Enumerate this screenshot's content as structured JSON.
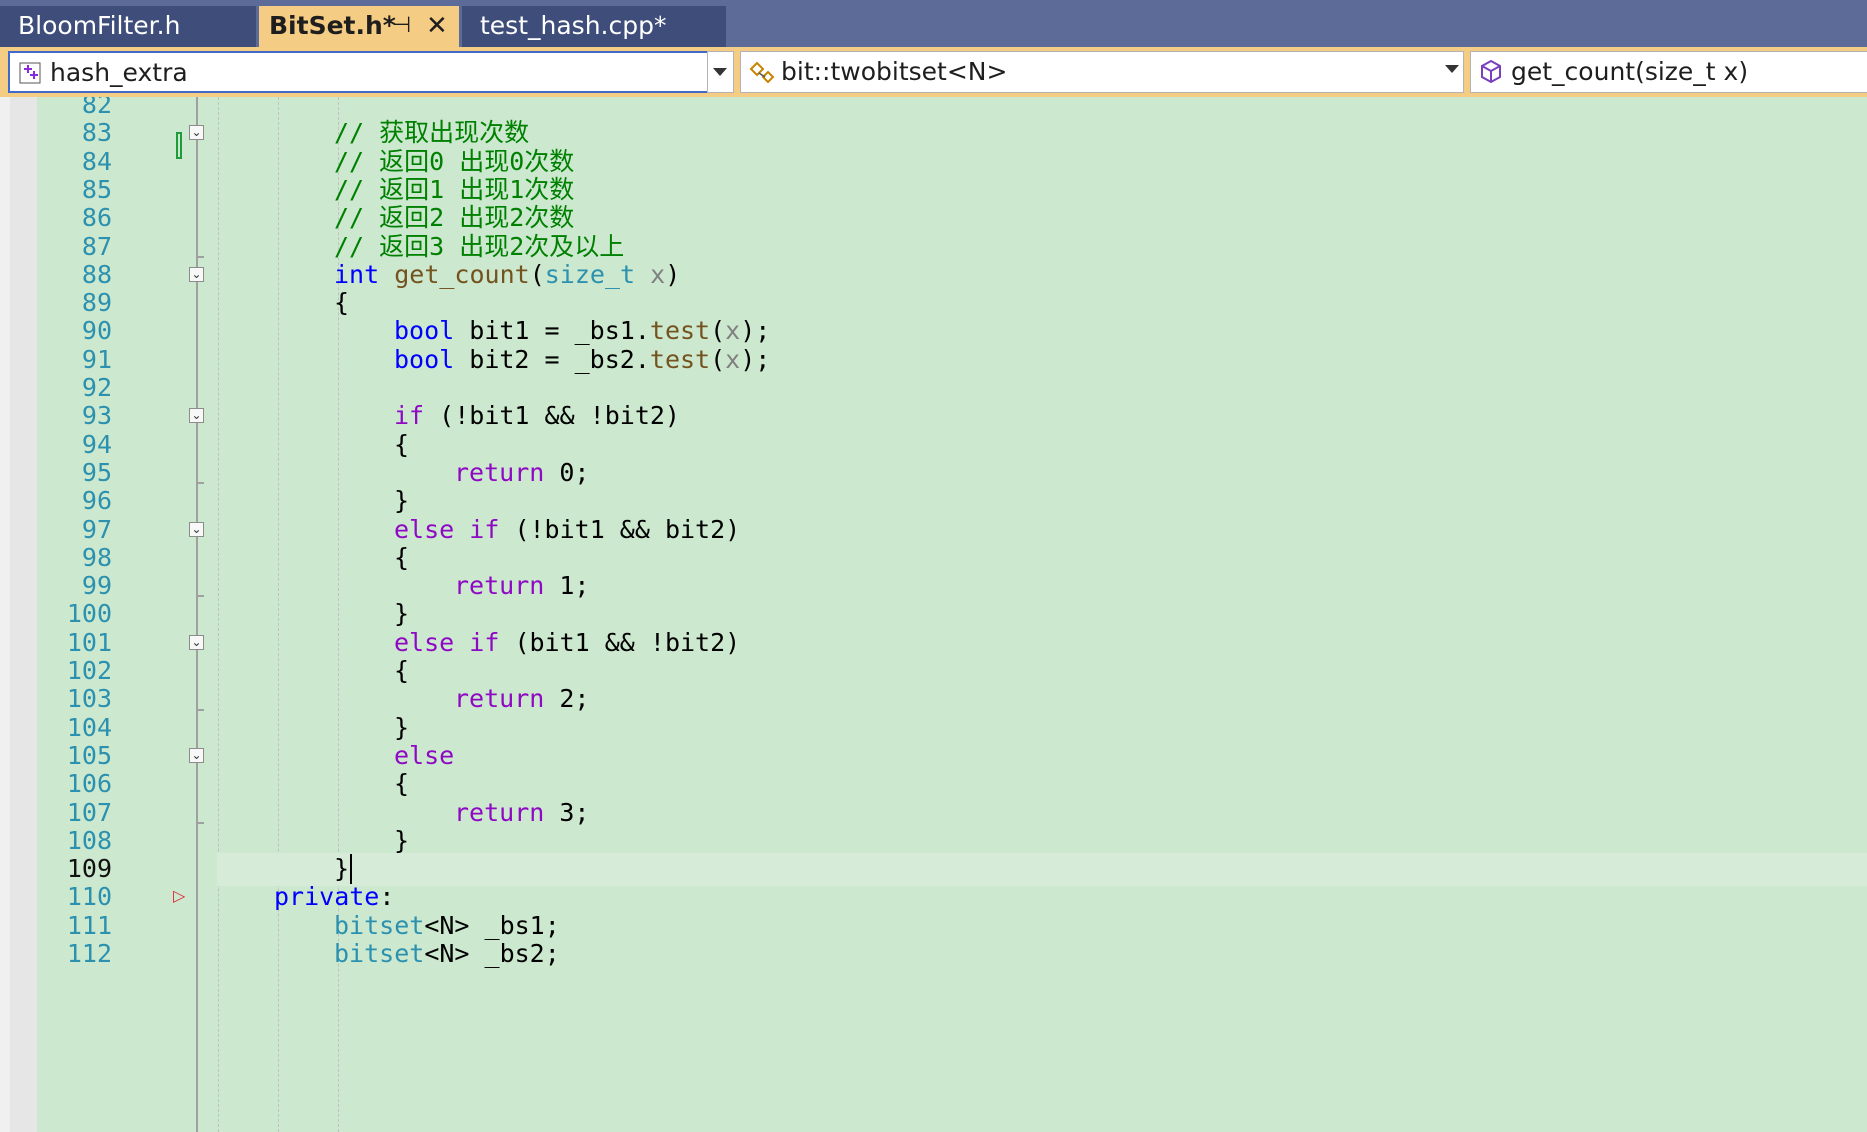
{
  "tabs": [
    {
      "label": "BloomFilter.h"
    },
    {
      "label": "BitSet.h*",
      "active": true
    },
    {
      "label": "test_hash.cpp*"
    }
  ],
  "tab_icons": {
    "pin": "⊣",
    "close": "✕"
  },
  "navbar": {
    "project": "hash_extra",
    "scope": "bit::twobitset<N>",
    "member": "get_count(size_t x)"
  },
  "nav_icons": {
    "project": "project-icon",
    "scope": "class-icon",
    "member": "method-icon"
  },
  "colors": {
    "editor_bg": "#cce8cf",
    "keyword": "#0000ff",
    "control_keyword": "#8f08c4",
    "type": "#2b91af",
    "function": "#74531f",
    "comment": "#008000",
    "parameter": "#808080",
    "line_number": "#2b91af",
    "tab_active": "#f5cc84"
  },
  "editor": {
    "current_line": 109,
    "lines": [
      {
        "n": "82",
        "indent": 0,
        "tokens": []
      },
      {
        "n": "83",
        "indent": 2,
        "tokens": [
          {
            "t": "// 获取出现次数",
            "c": "comment"
          }
        ]
      },
      {
        "n": "84",
        "indent": 2,
        "tokens": [
          {
            "t": "// 返回0 出现0次数",
            "c": "comment"
          }
        ]
      },
      {
        "n": "85",
        "indent": 2,
        "tokens": [
          {
            "t": "// 返回1 出现1次数",
            "c": "comment"
          }
        ]
      },
      {
        "n": "86",
        "indent": 2,
        "tokens": [
          {
            "t": "// 返回2 出现2次数",
            "c": "comment"
          }
        ]
      },
      {
        "n": "87",
        "indent": 2,
        "tokens": [
          {
            "t": "// 返回3 出现2次及以上",
            "c": "comment"
          }
        ]
      },
      {
        "n": "88",
        "indent": 2,
        "tokens": [
          {
            "t": "int",
            "c": "keyword"
          },
          {
            "t": " "
          },
          {
            "t": "get_count",
            "c": "function"
          },
          {
            "t": "("
          },
          {
            "t": "size_t",
            "c": "type"
          },
          {
            "t": " "
          },
          {
            "t": "x",
            "c": "parameter"
          },
          {
            "t": ")"
          }
        ]
      },
      {
        "n": "89",
        "indent": 2,
        "tokens": [
          {
            "t": "{"
          }
        ]
      },
      {
        "n": "90",
        "indent": 3,
        "tokens": [
          {
            "t": "bool",
            "c": "keyword"
          },
          {
            "t": " bit1 = _bs1."
          },
          {
            "t": "test",
            "c": "function"
          },
          {
            "t": "("
          },
          {
            "t": "x",
            "c": "parameter"
          },
          {
            "t": ");"
          }
        ]
      },
      {
        "n": "91",
        "indent": 3,
        "tokens": [
          {
            "t": "bool",
            "c": "keyword"
          },
          {
            "t": " bit2 = _bs2."
          },
          {
            "t": "test",
            "c": "function"
          },
          {
            "t": "("
          },
          {
            "t": "x",
            "c": "parameter"
          },
          {
            "t": ");"
          }
        ]
      },
      {
        "n": "92",
        "indent": 0,
        "tokens": []
      },
      {
        "n": "93",
        "indent": 3,
        "tokens": [
          {
            "t": "if",
            "c": "control"
          },
          {
            "t": " (!bit1 && !bit2)"
          }
        ]
      },
      {
        "n": "94",
        "indent": 3,
        "tokens": [
          {
            "t": "{"
          }
        ]
      },
      {
        "n": "95",
        "indent": 4,
        "tokens": [
          {
            "t": "return",
            "c": "control"
          },
          {
            "t": " 0;"
          }
        ]
      },
      {
        "n": "96",
        "indent": 3,
        "tokens": [
          {
            "t": "}"
          }
        ]
      },
      {
        "n": "97",
        "indent": 3,
        "tokens": [
          {
            "t": "else",
            "c": "control"
          },
          {
            "t": " "
          },
          {
            "t": "if",
            "c": "control"
          },
          {
            "t": " (!bit1 && bit2)"
          }
        ]
      },
      {
        "n": "98",
        "indent": 3,
        "tokens": [
          {
            "t": "{"
          }
        ]
      },
      {
        "n": "99",
        "indent": 4,
        "tokens": [
          {
            "t": "return",
            "c": "control"
          },
          {
            "t": " 1;"
          }
        ]
      },
      {
        "n": "100",
        "indent": 3,
        "tokens": [
          {
            "t": "}"
          }
        ]
      },
      {
        "n": "101",
        "indent": 3,
        "tokens": [
          {
            "t": "else",
            "c": "control"
          },
          {
            "t": " "
          },
          {
            "t": "if",
            "c": "control"
          },
          {
            "t": " (bit1 && !bit2)"
          }
        ]
      },
      {
        "n": "102",
        "indent": 3,
        "tokens": [
          {
            "t": "{"
          }
        ]
      },
      {
        "n": "103",
        "indent": 4,
        "tokens": [
          {
            "t": "return",
            "c": "control"
          },
          {
            "t": " 2;"
          }
        ]
      },
      {
        "n": "104",
        "indent": 3,
        "tokens": [
          {
            "t": "}"
          }
        ]
      },
      {
        "n": "105",
        "indent": 3,
        "tokens": [
          {
            "t": "else",
            "c": "control"
          }
        ]
      },
      {
        "n": "106",
        "indent": 3,
        "tokens": [
          {
            "t": "{"
          }
        ]
      },
      {
        "n": "107",
        "indent": 4,
        "tokens": [
          {
            "t": "return",
            "c": "control"
          },
          {
            "t": " 3;"
          }
        ]
      },
      {
        "n": "108",
        "indent": 3,
        "tokens": [
          {
            "t": "}"
          }
        ]
      },
      {
        "n": "109",
        "indent": 2,
        "tokens": [
          {
            "t": "}"
          }
        ]
      },
      {
        "n": "110",
        "indent": 1,
        "tokens": [
          {
            "t": "private",
            "c": "keyword"
          },
          {
            "t": ":"
          }
        ]
      },
      {
        "n": "111",
        "indent": 2,
        "tokens": [
          {
            "t": "bitset",
            "c": "type"
          },
          {
            "t": "<N> _bs1;"
          }
        ]
      },
      {
        "n": "112",
        "indent": 2,
        "tokens": [
          {
            "t": "bitset",
            "c": "type"
          },
          {
            "t": "<N> _bs2;"
          }
        ]
      }
    ]
  }
}
